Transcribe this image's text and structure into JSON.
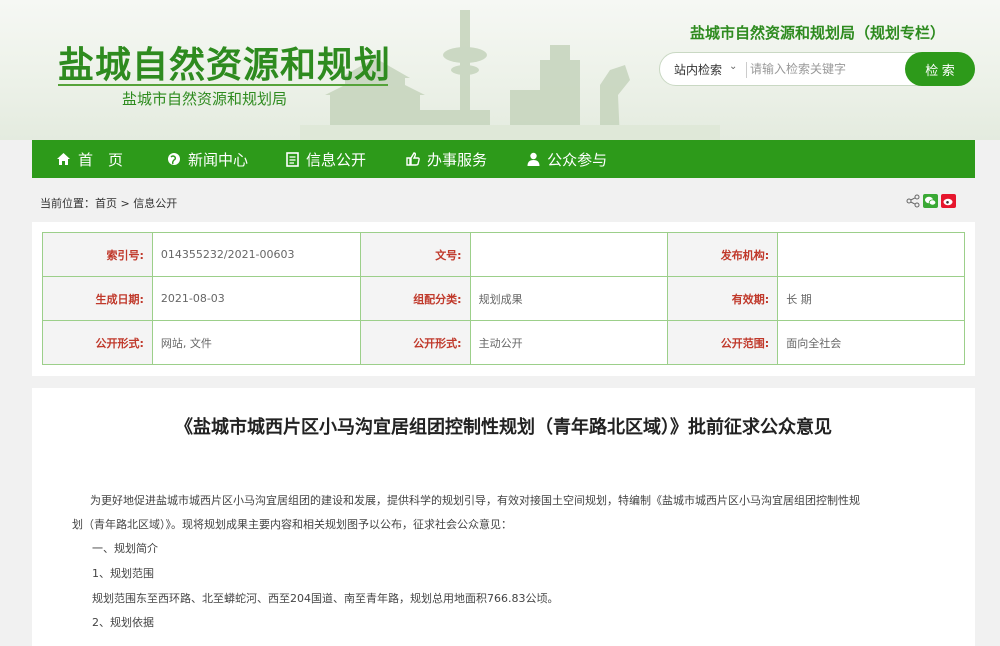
{
  "header": {
    "site_title": "盐城自然资源和规划",
    "site_subtitle": "盐城市自然资源和规划局",
    "zhuanlan": "盐城市自然资源和规划局（规划专栏）",
    "search": {
      "scope": "站内检索",
      "placeholder": "请输入检索关键字",
      "button": "检 索"
    }
  },
  "nav": [
    {
      "label": "首　页",
      "icon": "home-icon"
    },
    {
      "label": "新闻中心",
      "icon": "globe-icon"
    },
    {
      "label": "信息公开",
      "icon": "document-icon"
    },
    {
      "label": "办事服务",
      "icon": "thumbs-up-icon"
    },
    {
      "label": "公众参与",
      "icon": "user-icon"
    }
  ],
  "breadcrumb": "当前位置：首页 > 信息公开",
  "meta": [
    [
      {
        "k": "索引号:",
        "v": "014355232/2021-00603"
      },
      {
        "k": "文号:",
        "v": ""
      },
      {
        "k": "发布机构:",
        "v": ""
      }
    ],
    [
      {
        "k": "生成日期:",
        "v": "2021-08-03"
      },
      {
        "k": "组配分类:",
        "v": "规划成果"
      },
      {
        "k": "有效期:",
        "v": "长 期"
      }
    ],
    [
      {
        "k": "公开形式:",
        "v": "网站, 文件"
      },
      {
        "k": "公开形式:",
        "v": "主动公开"
      },
      {
        "k": "公开范围:",
        "v": "面向全社会"
      }
    ]
  ],
  "article": {
    "title": "《盐城市城西片区小马沟宜居组团控制性规划（青年路北区域）》批前征求公众意见",
    "p1_line1": "为更好地促进盐城市城西片区小马沟宜居组团的建设和发展，提供科学的规划引导，有效对接国土空间规划，特编制《盐城市城西片区小马沟宜居组团控制性规",
    "p1_line2": "划（青年路北区域）》。现将规划成果主要内容和相关规划图予以公布，征求社会公众意见：",
    "s1": "一、规划简介",
    "s1_1": "1、规划范围",
    "s1_1_text": "规划范围东至西环路、北至蟒蛇河、西至204国道、南至青年路，规划总用地面积766.83公顷。",
    "s1_2": "2、规划依据"
  },
  "colors": {
    "brand_green": "#2d9a1a",
    "key_red": "#c0392b"
  }
}
